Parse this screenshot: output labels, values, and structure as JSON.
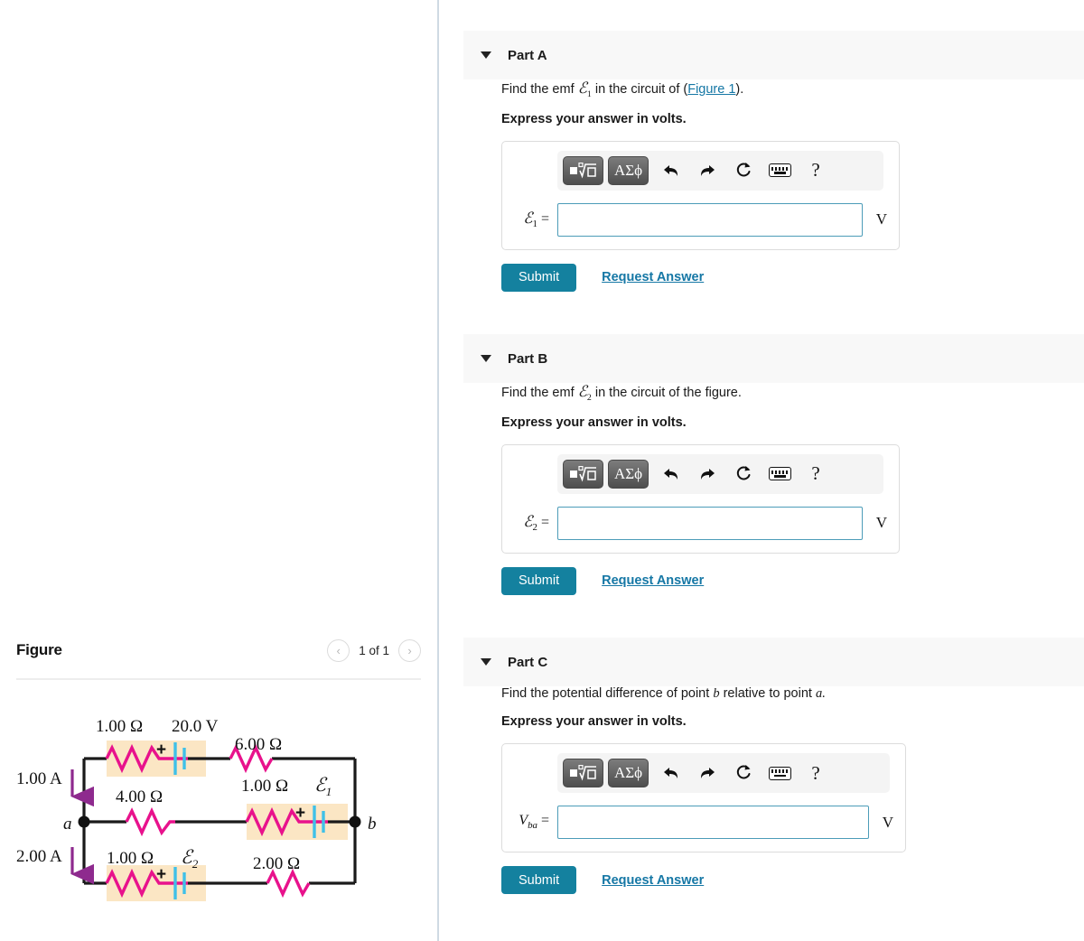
{
  "figure_panel": {
    "title": "Figure",
    "prev_icon": "chevron-left-icon",
    "next_icon": "chevron-right-icon",
    "prev_glyph": "‹",
    "next_glyph": "›",
    "counter": "1 of 1"
  },
  "toolbar": {
    "math_template_button": "√",
    "greek_button": "ΑΣϕ",
    "undo_icon": "undo-arrow-icon",
    "redo_icon": "redo-arrow-icon",
    "reset_icon": "reset-circular-arrow-icon",
    "keyboard_icon": "keyboard-icon",
    "help_label": "?"
  },
  "parts": [
    {
      "id": "part-a",
      "title": "Part A",
      "prompt_prefix": "Find the emf ",
      "prompt_symbol": "ℰ",
      "prompt_subscript": "1",
      "prompt_middle": " in the circuit of (",
      "prompt_link": "Figure 1",
      "prompt_suffix": ").",
      "express": "Express your answer in volts.",
      "answer_label_symbol": "ℰ",
      "answer_label_subscript": "1",
      "answer_label_equals": " =",
      "answer_value": "",
      "answer_placeholder": "",
      "unit": "V",
      "submit_label": "Submit",
      "request_label": "Request Answer"
    },
    {
      "id": "part-b",
      "title": "Part B",
      "prompt_prefix": "Find the emf ",
      "prompt_symbol": "ℰ",
      "prompt_subscript": "2",
      "prompt_middle": " in the circuit of the figure.",
      "prompt_link": "",
      "prompt_suffix": "",
      "express": "Express your answer in volts.",
      "answer_label_symbol": "ℰ",
      "answer_label_subscript": "2",
      "answer_label_equals": " =",
      "answer_value": "",
      "answer_placeholder": "",
      "unit": "V",
      "submit_label": "Submit",
      "request_label": "Request Answer"
    },
    {
      "id": "part-c",
      "title": "Part C",
      "prompt_prefix": "Find the potential difference of point ",
      "prompt_symbol": "b",
      "prompt_subscript": "",
      "prompt_middle": " relative to point ",
      "prompt_link": "",
      "prompt_suffix": "a.",
      "express": "Express your answer in volts.",
      "answer_label_symbol": "V",
      "answer_label_subscript": "ba",
      "answer_label_equals": " =",
      "answer_value": "",
      "answer_placeholder": "",
      "unit": "V",
      "submit_label": "Submit",
      "request_label": "Request Answer"
    }
  ],
  "circuit": {
    "labels": {
      "top_left_resistance": "1.00 Ω",
      "top_left_emf": "20.0 V",
      "top_right_resistance": "6.00 Ω",
      "middle_left_resistance": "4.00 Ω",
      "middle_right_resistance": "1.00 Ω",
      "middle_right_emf": "ℰ",
      "middle_right_emf_sub": "1",
      "bottom_left_resistance": "1.00 Ω",
      "bottom_left_emf": "ℰ",
      "bottom_left_emf_sub": "2",
      "bottom_right_resistance": "2.00 Ω",
      "current_top": "1.00 A",
      "current_bottom": "2.00 A",
      "node_a": "a",
      "node_b": "b",
      "plus_sign": "+"
    },
    "colors": {
      "resistor": "#e8128c",
      "battery": "#3fc0e8",
      "highlight": "#fbe6c4",
      "wire": "#1a1a1a",
      "arrow": "#8e2a8e"
    }
  },
  "theme": {
    "accent_teal": "#14819f",
    "link_blue": "#1577a5",
    "input_border": "#4c9cb8",
    "header_band": "#f8f8f8",
    "splitter": "#cfdae3"
  }
}
